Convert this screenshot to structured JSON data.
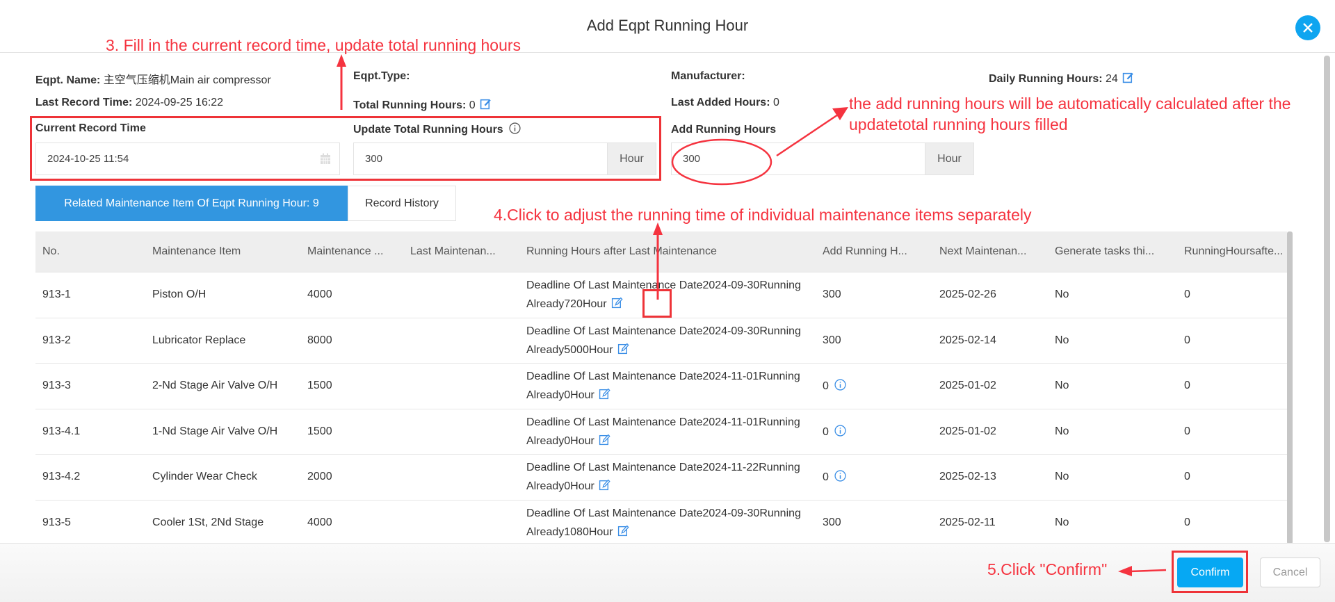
{
  "dialog": {
    "title": "Add Eqpt Running Hour",
    "close_icon": "close-icon"
  },
  "info": {
    "eqpt_name_label": "Eqpt. Name:",
    "eqpt_name": "主空气压缩机Main air compressor",
    "eqpt_type_label": "Eqpt.Type:",
    "eqpt_type": "",
    "manufacturer_label": "Manufacturer:",
    "manufacturer": "",
    "daily_label": "Daily Running Hours:",
    "daily": "24",
    "last_record_label": "Last Record Time:",
    "last_record": "2024-09-25 16:22",
    "total_label": "Total Running Hours:",
    "total": "0",
    "last_added_label": "Last Added Hours:",
    "last_added": "0"
  },
  "form": {
    "current_record_label": "Current Record Time",
    "current_record_value": "2024-10-25 11:54",
    "update_total_label": "Update Total Running Hours",
    "update_total_value": "300",
    "update_total_unit": "Hour",
    "add_label": "Add Running Hours",
    "add_value": "300",
    "add_unit": "Hour"
  },
  "tabs": [
    {
      "label": "Related Maintenance Item Of Eqpt Running Hour: 9",
      "active": true
    },
    {
      "label": "Record History",
      "active": false
    }
  ],
  "table": {
    "headers": [
      "No.",
      "Maintenance Item",
      "Maintenance ...",
      "Last Maintenan...",
      "Running Hours after Last Maintenance",
      "Add Running H...",
      "Next Maintenan...",
      "Generate tasks thi...",
      "RunningHoursafte..."
    ],
    "rows": [
      {
        "no": "913-1",
        "item": "Piston O/H",
        "cycle": "4000",
        "last": "",
        "running": "Deadline Of Last Maintenance Date2024-09-30Running Already720Hour",
        "add": "300",
        "add_info": false,
        "next": "2025-02-26",
        "gen": "No",
        "after": "0"
      },
      {
        "no": "913-2",
        "item": "Lubricator Replace",
        "cycle": "8000",
        "last": "",
        "running": "Deadline Of Last Maintenance Date2024-09-30Running Already5000Hour",
        "add": "300",
        "add_info": false,
        "next": "2025-02-14",
        "gen": "No",
        "after": "0"
      },
      {
        "no": "913-3",
        "item": "2-Nd Stage Air Valve O/H",
        "cycle": "1500",
        "last": "",
        "running": "Deadline Of Last Maintenance Date2024-11-01Running Already0Hour",
        "add": "0",
        "add_info": true,
        "next": "2025-01-02",
        "gen": "No",
        "after": "0"
      },
      {
        "no": "913-4.1",
        "item": "1-Nd Stage Air Valve O/H",
        "cycle": "1500",
        "last": "",
        "running": "Deadline Of Last Maintenance Date2024-11-01Running Already0Hour",
        "add": "0",
        "add_info": true,
        "next": "2025-01-02",
        "gen": "No",
        "after": "0"
      },
      {
        "no": "913-4.2",
        "item": "Cylinder Wear Check",
        "cycle": "2000",
        "last": "",
        "running": "Deadline Of Last Maintenance Date2024-11-22Running Already0Hour",
        "add": "0",
        "add_info": true,
        "next": "2025-02-13",
        "gen": "No",
        "after": "0"
      },
      {
        "no": "913-5",
        "item": "Cooler 1St, 2Nd Stage",
        "cycle": "4000",
        "last": "",
        "running": "Deadline Of Last Maintenance Date2024-09-30Running Already1080Hour",
        "add": "300",
        "add_info": false,
        "next": "2025-02-11",
        "gen": "No",
        "after": "0"
      }
    ]
  },
  "footer": {
    "confirm": "Confirm",
    "cancel": "Cancel"
  },
  "annotations": {
    "step3": "3. Fill in the current record time, update total running hours",
    "auto_line1": "the add running hours will be automatically calculated after the",
    "auto_line2": "updatetotal running hours filled",
    "step4": "4.Click to adjust the running time of individual maintenance items separately",
    "step5": "5.Click \"Confirm\""
  },
  "colors": {
    "accent": "#06a8f3",
    "tab_active": "#3296e0",
    "annotation": "#f5333f",
    "icon": "#3a8ee6"
  }
}
